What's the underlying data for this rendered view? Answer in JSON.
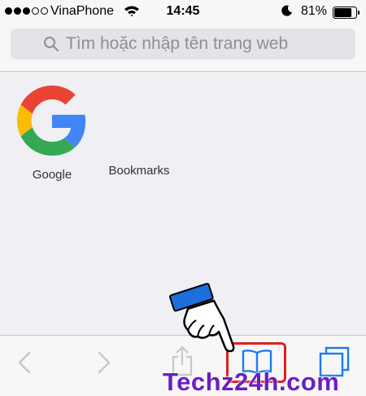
{
  "status_bar": {
    "carrier": "VinaPhone",
    "time": "14:45",
    "battery_percent": "81%",
    "battery_level": 0.81,
    "signal_bars_filled": 3,
    "signal_bars_total": 5
  },
  "search": {
    "placeholder": "Tìm hoặc nhập tên trang web"
  },
  "favorites": [
    {
      "label": "Google",
      "icon": "google-logo"
    },
    {
      "label": "Bookmarks",
      "icon": "blank-tile"
    }
  ],
  "toolbar": {
    "buttons": [
      "back-icon",
      "forward-icon",
      "share-icon",
      "bookmarks-icon",
      "tabs-icon"
    ],
    "highlighted": "bookmarks-icon"
  },
  "watermark": {
    "text": "Techz24h.com"
  },
  "colors": {
    "ios_blue": "#1a7cf5",
    "highlight_red": "#e0201e",
    "watermark_purple": "#6a1fc2"
  }
}
